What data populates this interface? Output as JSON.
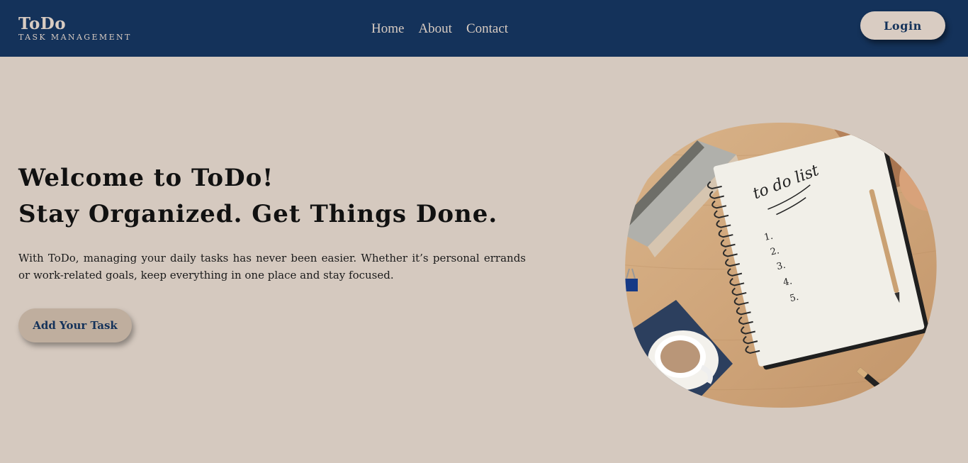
{
  "brand": {
    "title": "ToDo",
    "subtitle": "TASK MANAGEMENT"
  },
  "nav": {
    "links": [
      "Home",
      "About",
      "Contact"
    ],
    "login_label": "Login"
  },
  "hero": {
    "title_line1": "Welcome to ToDo!",
    "title_line2": "Stay Organized. Get Things Done.",
    "description": "With ToDo, managing your daily tasks has never been easier. Whether it’s personal errands or work-related goals, keep everything in one place and stay focused.",
    "cta_label": "Add Your Task"
  },
  "image": {
    "notebook_heading": "to do list",
    "list_numbers": [
      "1.",
      "2.",
      "3.",
      "4.",
      "5."
    ]
  },
  "colors": {
    "navbar": "#14325a",
    "background": "#d5c9bf",
    "accent_text": "#d9ccc2",
    "cta": "#bfae9e"
  }
}
